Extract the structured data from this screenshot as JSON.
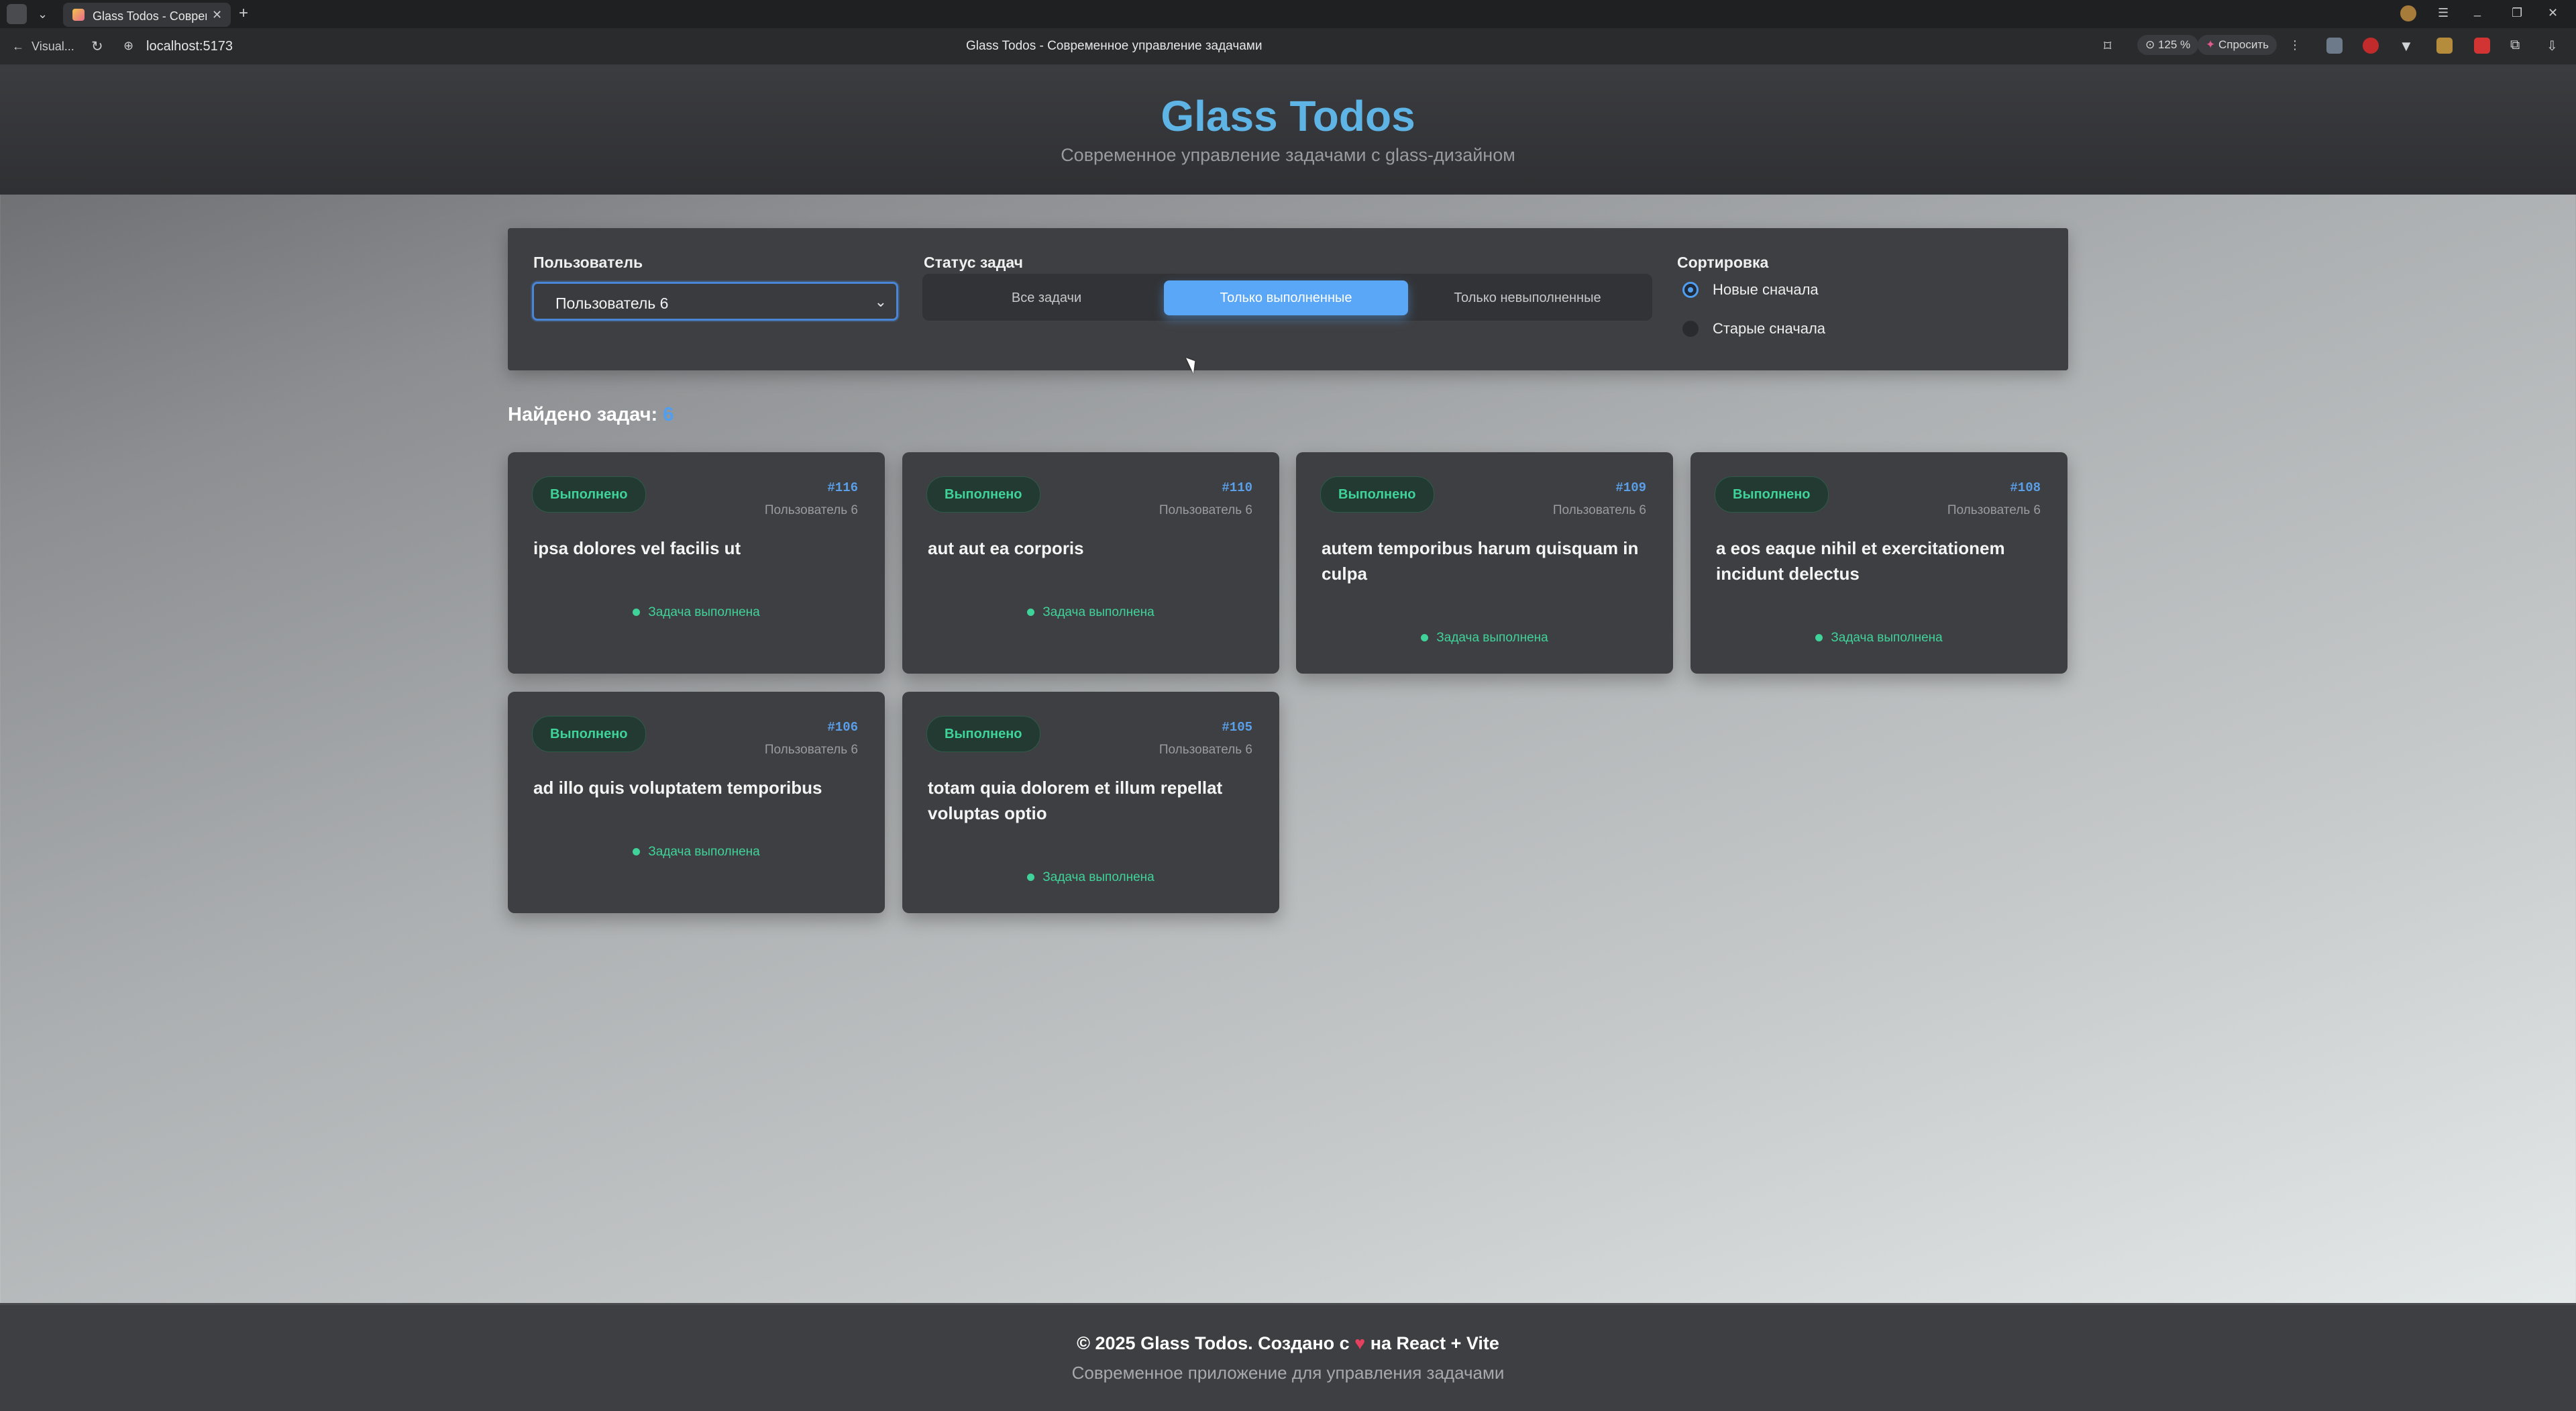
{
  "browser": {
    "tab_title": "Glass Todos - Современ",
    "back_label": "Visual...",
    "url": "localhost:5173",
    "page_title": "Glass Todos - Современное управление задачами",
    "zoom": "125 %",
    "ask_label": "Спросить"
  },
  "header": {
    "title": "Glass Todos",
    "subtitle": "Современное управление задачами с glass-дизайном"
  },
  "filters": {
    "user_label": "Пользователь",
    "user_selected": "Пользователь 6",
    "status_label": "Статус задач",
    "status_options": [
      "Все задачи",
      "Только выполненные",
      "Только невыполненные"
    ],
    "status_active": "Только выполненные",
    "sort_label": "Сортировка",
    "sort_options": [
      "Новые сначала",
      "Старые сначала"
    ],
    "sort_selected": "Новые сначала"
  },
  "results": {
    "found_label": "Найдено задач:",
    "count": "6"
  },
  "todos": [
    {
      "badge": "Выполнено",
      "id": "#116",
      "user": "Пользователь 6",
      "title": "ipsa dolores vel facilis ut",
      "status_text": "Задача выполнена"
    },
    {
      "badge": "Выполнено",
      "id": "#110",
      "user": "Пользователь 6",
      "title": "aut aut ea corporis",
      "status_text": "Задача выполнена"
    },
    {
      "badge": "Выполнено",
      "id": "#109",
      "user": "Пользователь 6",
      "title": "autem temporibus harum quisquam in culpa",
      "status_text": "Задача выполнена"
    },
    {
      "badge": "Выполнено",
      "id": "#108",
      "user": "Пользователь 6",
      "title": "a eos eaque nihil et exercitationem incidunt delectus",
      "status_text": "Задача выполнена"
    },
    {
      "badge": "Выполнено",
      "id": "#106",
      "user": "Пользователь 6",
      "title": "ad illo quis voluptatem temporibus",
      "status_text": "Задача выполнена"
    },
    {
      "badge": "Выполнено",
      "id": "#105",
      "user": "Пользователь 6",
      "title": "totam quia dolorem et illum repellat voluptas optio",
      "status_text": "Задача выполнена"
    }
  ],
  "footer": {
    "line1_prefix": "© 2025 Glass Todos. Создано с",
    "heart": "♥",
    "line1_suffix": "на React + Vite",
    "line2": "Современное приложение для управления задачами"
  },
  "colors": {
    "accent": "#5aa7f7",
    "title_blue": "#5fb4e6",
    "done_green": "#3fd39a"
  }
}
